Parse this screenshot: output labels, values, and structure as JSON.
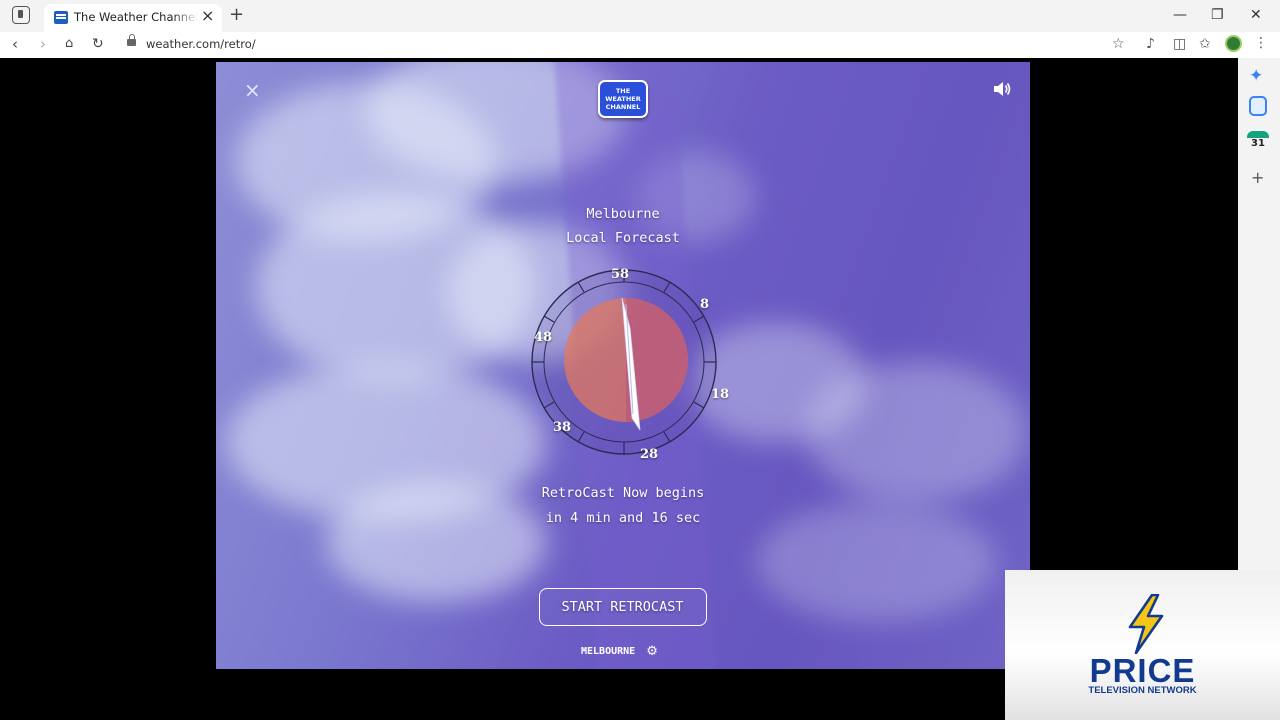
{
  "browser": {
    "tab_title": "The Weather Channel - RetroCast",
    "url": "weather.com/retro/",
    "window_controls": {
      "minimize": "—",
      "restore": "❐",
      "close": "✕"
    }
  },
  "sidebar": {
    "calendar_day": "31"
  },
  "player": {
    "logo_text": "THE WEATHER CHANNEL",
    "city": "Melbourne",
    "subtitle": "Local Forecast",
    "dial_labels": [
      "58",
      "8",
      "18",
      "28",
      "38",
      "48"
    ],
    "countdown_line1": "RetroCast Now begins",
    "countdown_line2": "in 4 min and 16 sec",
    "start_button": "START RETROCAST",
    "location_label": "MELBOURNE"
  },
  "overlay": {
    "brand": "PRICE",
    "network": "Television Network"
  },
  "colors": {
    "sky_purple": "#6b5bc4",
    "logo_blue": "#2a4fd8",
    "overlay_navy": "#123a8f",
    "bolt_yellow": "#f5c518"
  }
}
